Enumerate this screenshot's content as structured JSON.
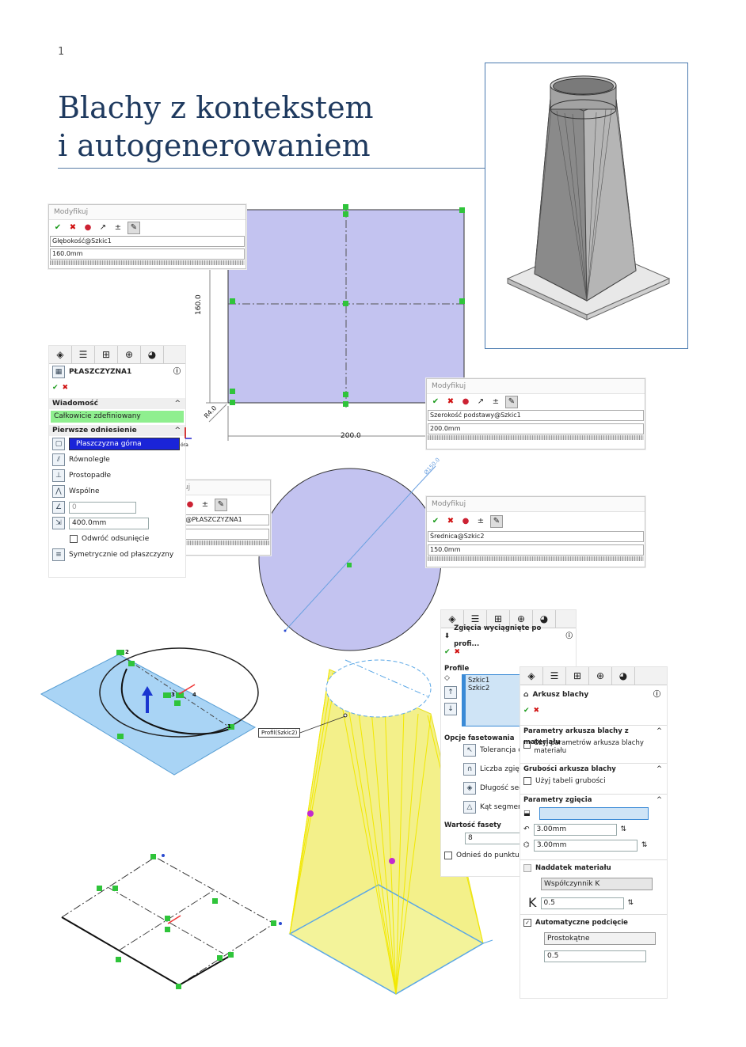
{
  "page_number": "1",
  "title": {
    "line1": "Blachy z kontekstem",
    "line2": "i autogenerowaniem"
  },
  "sketch_rect": {
    "dim_width": "200.0",
    "dim_height": "160.0",
    "dim_radius": "R4.0"
  },
  "circle_sketch": {
    "dim_diameter": "Ø150.0"
  },
  "modify1": {
    "header": "Modyfikuj",
    "param": "Głębokość@Szkic1",
    "value": "160.0mm"
  },
  "modify2": {
    "header": "Modyfikuj",
    "param": "Szerokość podstawy@Szkic1",
    "value": "200.0mm"
  },
  "modify3": {
    "header": "Modyfikuj",
    "param": "Wysokość@PŁASZCZYZNA1",
    "value": "400.0mm"
  },
  "modify4": {
    "header": "Modyfikuj",
    "param": "Średnica@Szkic2",
    "value": "150.0mm"
  },
  "plane_pm": {
    "title": "PŁASZCZYZNA1",
    "message_group": "Wiadomość",
    "message": "Całkowicie zdefiniowany",
    "first_ref_group": "Pierwsze odniesienie",
    "ref_value": "Płaszczyzna górna",
    "ref_suffix": "óra",
    "opts": [
      "Równoległe",
      "Prostopadłe",
      "Wspólne"
    ],
    "angle_value": "0",
    "distance_value": "400.0mm",
    "flip": "Odwróć odsunięcie",
    "sym": "Symetrycznie od płaszczyzny"
  },
  "loft_pm": {
    "title": "Zgięcia wyciągnięte po profi...",
    "profile_group": "Profile",
    "profiles": [
      "Szkic1",
      "Szkic2"
    ],
    "facet_group": "Opcje fasetowania",
    "facet_opts": [
      "Tolerancja cię",
      "Liczba zgięć",
      "Długość segm",
      "Kąt segmentu"
    ],
    "facet_value_label": "Wartość fasety",
    "facet_value": "8",
    "ref_end": "Odnieś do punktu kor"
  },
  "sheet_pm": {
    "title": "Arkusz blachy",
    "g1": "Parametry arkusza blachy z materiału",
    "g1_chk": "Użyj parametrów arkusza blachy materiału",
    "g2": "Grubości arkusza blachy",
    "g2_chk": "Użyj tabeli grubości",
    "g3": "Parametry zgięcia",
    "radius": "3.00mm",
    "thickness": "3.00mm",
    "g4": "Naddatek materiału",
    "allowance_type": "Współczynnik K",
    "k_label": "K",
    "k_value": "0.5",
    "g5": "Automatyczne podcięcie",
    "relief_type": "Prostokątne",
    "relief_ratio": "0.5"
  },
  "profile_label": "Profil(Szkic2)",
  "sketch_marks": {
    "n1": "1",
    "n2": "2",
    "n3": "3",
    "n4": "4"
  },
  "colors": {
    "sketch_fill": "#c3c3f0",
    "plane_fill": "#a9d4f5",
    "sheet_fill": "#f3f08a",
    "title": "#1f3a5f"
  }
}
